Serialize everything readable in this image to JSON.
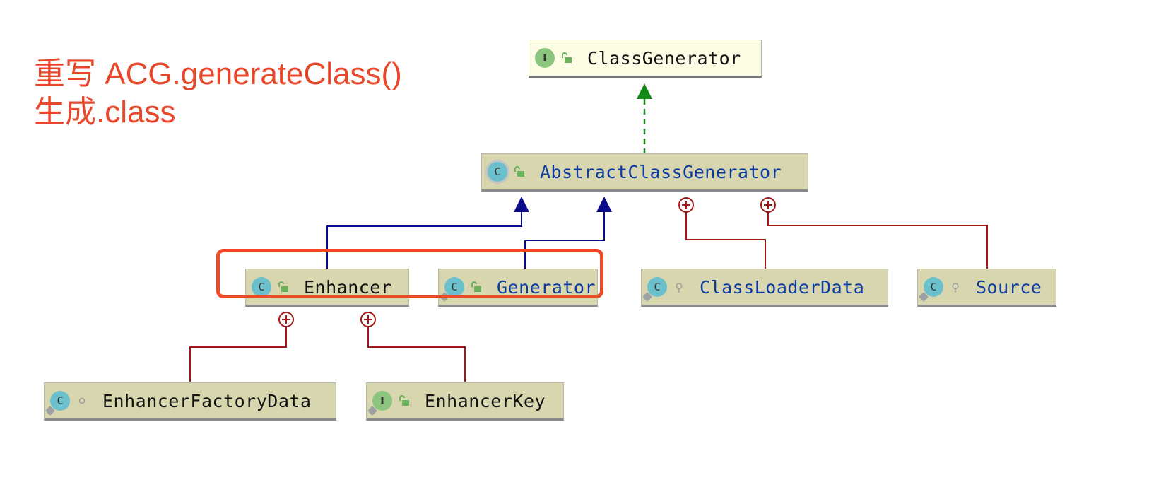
{
  "annotation": {
    "line1": "重写 ACG.generateClass()",
    "line2": "生成.class",
    "color": "#e8472a"
  },
  "nodes": {
    "class_generator": {
      "name": "ClassGenerator",
      "kind": "interface",
      "visibility": "public"
    },
    "abstract_class_generator": {
      "name": "AbstractClassGenerator",
      "kind": "abstract-class",
      "visibility": "public"
    },
    "enhancer": {
      "name": "Enhancer",
      "kind": "class",
      "visibility": "public"
    },
    "generator": {
      "name": "Generator",
      "kind": "class",
      "visibility": "public",
      "nested": true
    },
    "class_loader_data": {
      "name": "ClassLoaderData",
      "kind": "class",
      "visibility": "protected",
      "nested": true
    },
    "source": {
      "name": "Source",
      "kind": "class",
      "visibility": "protected",
      "nested": true
    },
    "enhancer_factory_data": {
      "name": "EnhancerFactoryData",
      "kind": "class",
      "visibility": "package-private",
      "nested": true
    },
    "enhancer_key": {
      "name": "EnhancerKey",
      "kind": "interface",
      "visibility": "public",
      "nested": true
    }
  },
  "edges": [
    {
      "from": "AbstractClassGenerator",
      "to": "ClassGenerator",
      "type": "implements"
    },
    {
      "from": "Enhancer",
      "to": "AbstractClassGenerator",
      "type": "extends"
    },
    {
      "from": "Generator",
      "to": "AbstractClassGenerator",
      "type": "extends"
    },
    {
      "from": "ClassLoaderData",
      "to": "AbstractClassGenerator",
      "type": "inner-class"
    },
    {
      "from": "Source",
      "to": "AbstractClassGenerator",
      "type": "inner-class"
    },
    {
      "from": "EnhancerFactoryData",
      "to": "Enhancer",
      "type": "inner-class"
    },
    {
      "from": "EnhancerKey",
      "to": "Enhancer",
      "type": "inner-class"
    }
  ],
  "colors": {
    "implements": "#138a13",
    "extends": "#0b0b8a",
    "inner": "#a01818",
    "highlight": "#ec4a28"
  }
}
